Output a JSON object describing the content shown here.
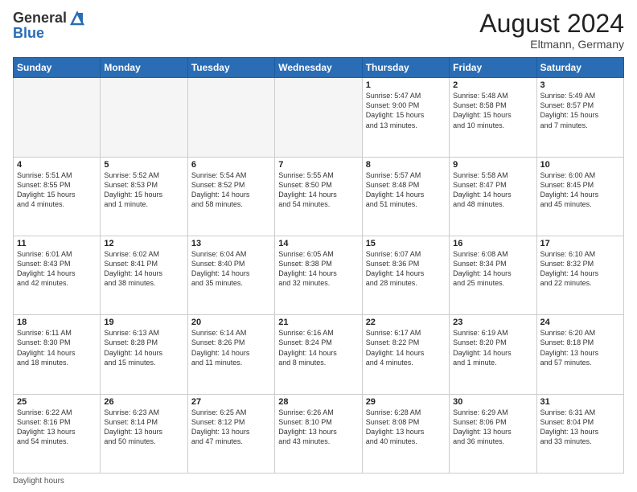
{
  "header": {
    "logo_line1": "General",
    "logo_line2": "Blue",
    "month_year": "August 2024",
    "location": "Eltmann, Germany"
  },
  "days_of_week": [
    "Sunday",
    "Monday",
    "Tuesday",
    "Wednesday",
    "Thursday",
    "Friday",
    "Saturday"
  ],
  "weeks": [
    [
      {
        "date": "",
        "text": ""
      },
      {
        "date": "",
        "text": ""
      },
      {
        "date": "",
        "text": ""
      },
      {
        "date": "",
        "text": ""
      },
      {
        "date": "1",
        "text": "Sunrise: 5:47 AM\nSunset: 9:00 PM\nDaylight: 15 hours\nand 13 minutes."
      },
      {
        "date": "2",
        "text": "Sunrise: 5:48 AM\nSunset: 8:58 PM\nDaylight: 15 hours\nand 10 minutes."
      },
      {
        "date": "3",
        "text": "Sunrise: 5:49 AM\nSunset: 8:57 PM\nDaylight: 15 hours\nand 7 minutes."
      }
    ],
    [
      {
        "date": "4",
        "text": "Sunrise: 5:51 AM\nSunset: 8:55 PM\nDaylight: 15 hours\nand 4 minutes."
      },
      {
        "date": "5",
        "text": "Sunrise: 5:52 AM\nSunset: 8:53 PM\nDaylight: 15 hours\nand 1 minute."
      },
      {
        "date": "6",
        "text": "Sunrise: 5:54 AM\nSunset: 8:52 PM\nDaylight: 14 hours\nand 58 minutes."
      },
      {
        "date": "7",
        "text": "Sunrise: 5:55 AM\nSunset: 8:50 PM\nDaylight: 14 hours\nand 54 minutes."
      },
      {
        "date": "8",
        "text": "Sunrise: 5:57 AM\nSunset: 8:48 PM\nDaylight: 14 hours\nand 51 minutes."
      },
      {
        "date": "9",
        "text": "Sunrise: 5:58 AM\nSunset: 8:47 PM\nDaylight: 14 hours\nand 48 minutes."
      },
      {
        "date": "10",
        "text": "Sunrise: 6:00 AM\nSunset: 8:45 PM\nDaylight: 14 hours\nand 45 minutes."
      }
    ],
    [
      {
        "date": "11",
        "text": "Sunrise: 6:01 AM\nSunset: 8:43 PM\nDaylight: 14 hours\nand 42 minutes."
      },
      {
        "date": "12",
        "text": "Sunrise: 6:02 AM\nSunset: 8:41 PM\nDaylight: 14 hours\nand 38 minutes."
      },
      {
        "date": "13",
        "text": "Sunrise: 6:04 AM\nSunset: 8:40 PM\nDaylight: 14 hours\nand 35 minutes."
      },
      {
        "date": "14",
        "text": "Sunrise: 6:05 AM\nSunset: 8:38 PM\nDaylight: 14 hours\nand 32 minutes."
      },
      {
        "date": "15",
        "text": "Sunrise: 6:07 AM\nSunset: 8:36 PM\nDaylight: 14 hours\nand 28 minutes."
      },
      {
        "date": "16",
        "text": "Sunrise: 6:08 AM\nSunset: 8:34 PM\nDaylight: 14 hours\nand 25 minutes."
      },
      {
        "date": "17",
        "text": "Sunrise: 6:10 AM\nSunset: 8:32 PM\nDaylight: 14 hours\nand 22 minutes."
      }
    ],
    [
      {
        "date": "18",
        "text": "Sunrise: 6:11 AM\nSunset: 8:30 PM\nDaylight: 14 hours\nand 18 minutes."
      },
      {
        "date": "19",
        "text": "Sunrise: 6:13 AM\nSunset: 8:28 PM\nDaylight: 14 hours\nand 15 minutes."
      },
      {
        "date": "20",
        "text": "Sunrise: 6:14 AM\nSunset: 8:26 PM\nDaylight: 14 hours\nand 11 minutes."
      },
      {
        "date": "21",
        "text": "Sunrise: 6:16 AM\nSunset: 8:24 PM\nDaylight: 14 hours\nand 8 minutes."
      },
      {
        "date": "22",
        "text": "Sunrise: 6:17 AM\nSunset: 8:22 PM\nDaylight: 14 hours\nand 4 minutes."
      },
      {
        "date": "23",
        "text": "Sunrise: 6:19 AM\nSunset: 8:20 PM\nDaylight: 14 hours\nand 1 minute."
      },
      {
        "date": "24",
        "text": "Sunrise: 6:20 AM\nSunset: 8:18 PM\nDaylight: 13 hours\nand 57 minutes."
      }
    ],
    [
      {
        "date": "25",
        "text": "Sunrise: 6:22 AM\nSunset: 8:16 PM\nDaylight: 13 hours\nand 54 minutes."
      },
      {
        "date": "26",
        "text": "Sunrise: 6:23 AM\nSunset: 8:14 PM\nDaylight: 13 hours\nand 50 minutes."
      },
      {
        "date": "27",
        "text": "Sunrise: 6:25 AM\nSunset: 8:12 PM\nDaylight: 13 hours\nand 47 minutes."
      },
      {
        "date": "28",
        "text": "Sunrise: 6:26 AM\nSunset: 8:10 PM\nDaylight: 13 hours\nand 43 minutes."
      },
      {
        "date": "29",
        "text": "Sunrise: 6:28 AM\nSunset: 8:08 PM\nDaylight: 13 hours\nand 40 minutes."
      },
      {
        "date": "30",
        "text": "Sunrise: 6:29 AM\nSunset: 8:06 PM\nDaylight: 13 hours\nand 36 minutes."
      },
      {
        "date": "31",
        "text": "Sunrise: 6:31 AM\nSunset: 8:04 PM\nDaylight: 13 hours\nand 33 minutes."
      }
    ]
  ],
  "footer": {
    "note": "Daylight hours"
  }
}
